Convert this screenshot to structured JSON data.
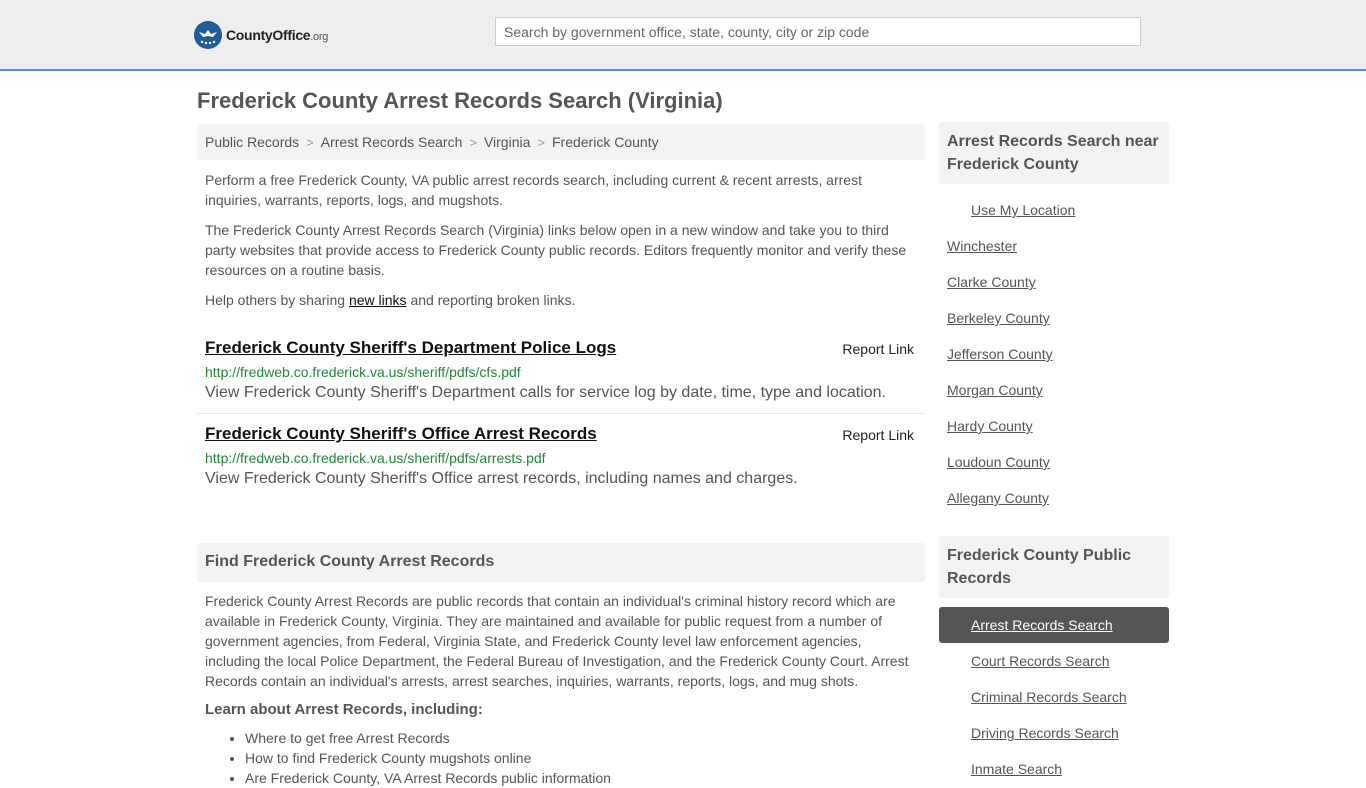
{
  "header": {
    "logo_brand": "CountyOffice",
    "logo_tld": ".org",
    "search_placeholder": "Search by government office, state, county, city or zip code"
  },
  "page_title": "Frederick County Arrest Records Search (Virginia)",
  "breadcrumbs": [
    "Public Records",
    "Arrest Records Search",
    "Virginia",
    "Frederick County"
  ],
  "intro": {
    "p1": "Perform a free Frederick County, VA public arrest records search, including current & recent arrests, arrest inquiries, warrants, reports, logs, and mugshots.",
    "p2": "The Frederick County Arrest Records Search (Virginia) links below open in a new window and take you to third party websites that provide access to Frederick County public records. Editors frequently monitor and verify these resources on a routine basis.",
    "p3_before": "Help others by sharing ",
    "p3_link": "new links",
    "p3_after": " and reporting broken links."
  },
  "links": [
    {
      "title": "Frederick County Sheriff's Department Police Logs",
      "report": "Report Link",
      "url": "http://fredweb.co.frederick.va.us/sheriff/pdfs/cfs.pdf",
      "desc": "View Frederick County Sheriff's Department calls for service log by date, time, type and location."
    },
    {
      "title": "Frederick County Sheriff's Office Arrest Records",
      "report": "Report Link",
      "url": "http://fredweb.co.frederick.va.us/sheriff/pdfs/arrests.pdf",
      "desc": "View Frederick County Sheriff's Office arrest records, including names and charges."
    }
  ],
  "find_section": {
    "heading": "Find Frederick County Arrest Records",
    "body": "Frederick County Arrest Records are public records that contain an individual's criminal history record which are available in Frederick County, Virginia. They are maintained and available for public request from a number of government agencies, from Federal, Virginia State, and Frederick County level law enforcement agencies, including the local Police Department, the Federal Bureau of Investigation, and the Frederick County Court. Arrest Records contain an individual's arrests, arrest searches, inquiries, warrants, reports, logs, and mug shots.",
    "learn_heading": "Learn about Arrest Records, including:",
    "learn_items": [
      "Where to get free Arrest Records",
      "How to find Frederick County mugshots online",
      "Are Frederick County, VA Arrest Records public information"
    ]
  },
  "sidebar": {
    "nearby_heading": "Arrest Records Search near Frederick County",
    "nearby_items": [
      "Use My Location",
      "Winchester",
      "Clarke County",
      "Berkeley County",
      "Jefferson County",
      "Morgan County",
      "Hardy County",
      "Loudoun County",
      "Allegany County"
    ],
    "public_heading": "Frederick County Public Records",
    "public_items": [
      "Arrest Records Search",
      "Court Records Search",
      "Criminal Records Search",
      "Driving Records Search",
      "Inmate Search"
    ]
  },
  "colors": {
    "accent_border": "#4a90d9",
    "url_green": "#218838",
    "active_bg": "#555555"
  }
}
